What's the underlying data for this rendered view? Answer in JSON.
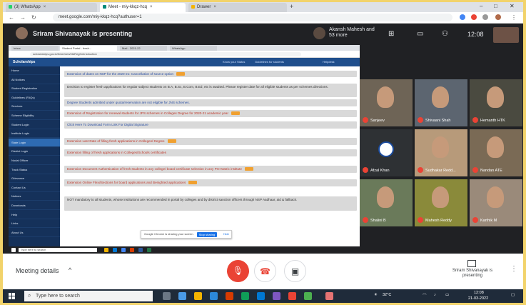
{
  "browser": {
    "tabs": [
      {
        "label": "(3) WhatsApp",
        "color": "#25d366"
      },
      {
        "label": "Meet - miy-kkqz-hcq",
        "color": "#00897b"
      },
      {
        "label": "Drawer",
        "color": "#f4b400"
      }
    ],
    "url": "meet.google.com/miy-kkqz-hcq?authuser=1"
  },
  "meet": {
    "presenting_text": "Sriram Shivanayak is presenting",
    "pinned_name": "Akansh Mahesh and 53 more",
    "clock": "12:08",
    "meeting_details_label": "Meeting details",
    "present_label": "Sriram Shivanayak is presenting"
  },
  "shared_screen": {
    "tabs": [
      "Inbox",
      "Student Portal - fresh...",
      "Mail - 2021-22",
      "WhatsApp"
    ],
    "url": "scholarships.gov.in/fresh/newStdRegfrmInstruction",
    "brand": "Scholarships",
    "header_links": [
      "Know your Status",
      "Guidelines for students",
      "Helpdesk"
    ],
    "sidebar": [
      "Home",
      "All Notices",
      "Student Registration",
      "Guidelines (FAQs)",
      "Services",
      "Scheme Eligibility",
      "Student Login",
      "Institute Login",
      "State Login",
      "District Login",
      "Nodal Officer",
      "Track Status",
      "Grievance",
      "Contact Us",
      "Notices",
      "Downloads",
      "Help",
      "Links",
      "About Us"
    ],
    "notices": [
      {
        "text": "Extension of dates on NSP for the 2020-21: Cancellation of source option",
        "color": "blue",
        "badge": true
      },
      {
        "text": "Decision to register fresh applications for regular subject students on B.A, B.Sc, B.Com, B.Ed, etc is awaited. Please register date for all eligible students as per schemes directions.",
        "color": "dark",
        "badge": false
      },
      {
        "text": "Degree Students admitted under quota/reservation are not eligible for JNS schemes.",
        "color": "blue",
        "badge": false
      },
      {
        "text": "Extension of Registration for renewal students for JPS schemes in Colleges Degree for 2020-21 academic year",
        "color": "red",
        "badge": true
      },
      {
        "text": "Click Here To Download Form Link For Digital Signature",
        "color": "blue",
        "badge": false
      },
      {
        "text": "Extension Last Date of filling fresh applications in Colleges/ Degree",
        "color": "red",
        "badge": true
      },
      {
        "text": "Extension filling of fresh applications in Colleges/Schools certificates",
        "color": "red",
        "badge": false
      },
      {
        "text": "Extension Document Authentication of fresh students in any college/ board certificate selection in any Pre-Matric institute",
        "color": "red",
        "badge": true
      },
      {
        "text": "Extension Online Flexi/Sections for board applications and Benighted applications",
        "color": "red",
        "badge": true
      },
      {
        "text": "NOT mandatory to all students, whose institutions are recommended in portal by colleges and by district sanction officers through NSP Aadhaar, aid & fallback.",
        "color": "dark",
        "badge": false
      }
    ],
    "popup": {
      "text": "Google Chrome is sharing your screen.",
      "button": "Stop sharing",
      "hide": "Hide"
    },
    "taskbar_search": "Type here to search"
  },
  "participants": [
    {
      "name": "Sanjeev",
      "bg": "#6e6456"
    },
    {
      "name": "Shivaani Shah",
      "bg": "#5c6570"
    },
    {
      "name": "Hemanth HTK",
      "bg": "#4a4a40"
    },
    {
      "name": "Afzal Khan",
      "bg": "#2e3134"
    },
    {
      "name": "Sudhakar Redd...",
      "bg": "#b79a7a"
    },
    {
      "name": "Nandan ATE",
      "bg": "#7a6a55"
    },
    {
      "name": "Shalini B",
      "bg": "#6a7a5a"
    },
    {
      "name": "Mahesh Reddy",
      "bg": "#8a8a3a"
    },
    {
      "name": "Karthik M",
      "bg": "#9a8a7a"
    }
  ],
  "taskbar": {
    "search_placeholder": "Type here to search",
    "weather": "32°C",
    "time": "12:08",
    "date": "21-03-2022"
  }
}
